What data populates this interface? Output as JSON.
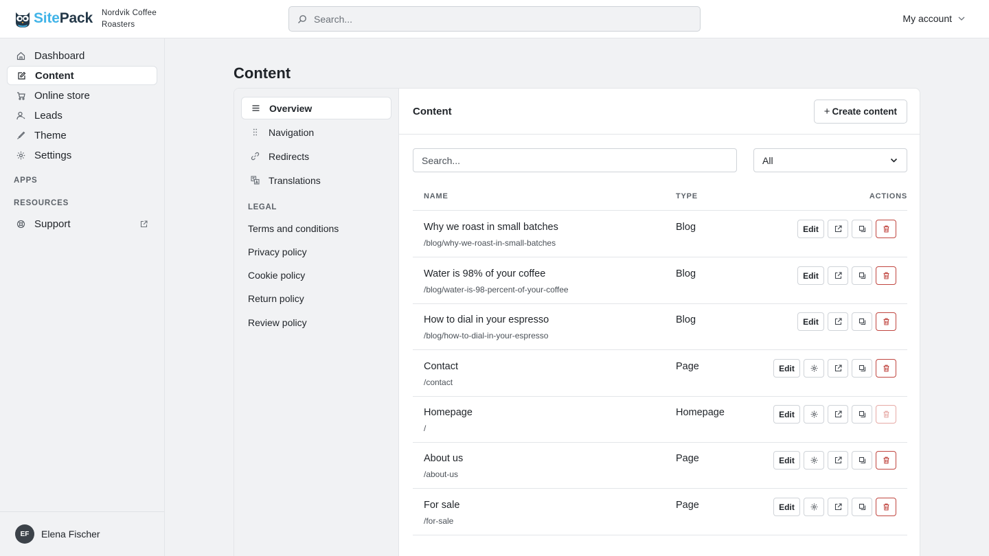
{
  "brand": {
    "name_part1": "Site",
    "name_part2": "Pack",
    "org_name": "Nordvik Coffee Roasters"
  },
  "top_search": {
    "placeholder": "Search..."
  },
  "account": {
    "label": "My account"
  },
  "sidebar": {
    "items": [
      {
        "label": "Dashboard",
        "icon": "home-icon"
      },
      {
        "label": "Content",
        "icon": "edit-icon",
        "active": true
      },
      {
        "label": "Online store",
        "icon": "cart-icon"
      },
      {
        "label": "Leads",
        "icon": "user-icon"
      },
      {
        "label": "Theme",
        "icon": "brush-icon"
      },
      {
        "label": "Settings",
        "icon": "gear-icon"
      }
    ],
    "apps_heading": "APPS",
    "resources_heading": "RESOURCES",
    "support_label": "Support",
    "user": {
      "initials": "EF",
      "name": "Elena Fischer"
    }
  },
  "page": {
    "title": "Content"
  },
  "subnav": {
    "items": [
      {
        "label": "Overview",
        "active": true
      },
      {
        "label": "Navigation"
      },
      {
        "label": "Redirects"
      },
      {
        "label": "Translations"
      }
    ],
    "legal_heading": "LEGAL",
    "legal_items": [
      "Terms and conditions",
      "Privacy policy",
      "Cookie policy",
      "Return policy",
      "Review policy"
    ]
  },
  "content": {
    "title": "Content",
    "create_label": "Create content",
    "search_placeholder": "Search...",
    "filter_value": "All",
    "columns": {
      "name": "NAME",
      "type": "TYPE",
      "actions": "ACTIONS"
    },
    "edit_label": "Edit",
    "rows": [
      {
        "name": "Why we roast in small batches",
        "path": "/blog/why-we-roast-in-small-batches",
        "type": "Blog"
      },
      {
        "name": "Water is 98% of your coffee",
        "path": "/blog/water-is-98-percent-of-your-coffee",
        "type": "Blog"
      },
      {
        "name": "How to dial in your espresso",
        "path": "/blog/how-to-dial-in-your-espresso",
        "type": "Blog"
      },
      {
        "name": "Contact",
        "path": "/contact",
        "type": "Page"
      },
      {
        "name": "Homepage",
        "path": "/",
        "type": "Homepage"
      },
      {
        "name": "About us",
        "path": "/about-us",
        "type": "Page"
      },
      {
        "name": "For sale",
        "path": "/for-sale",
        "type": "Page"
      }
    ]
  },
  "colors": {
    "accent_blue": "#41b4e8",
    "brand_dark": "#243848",
    "danger": "#c0453f"
  }
}
